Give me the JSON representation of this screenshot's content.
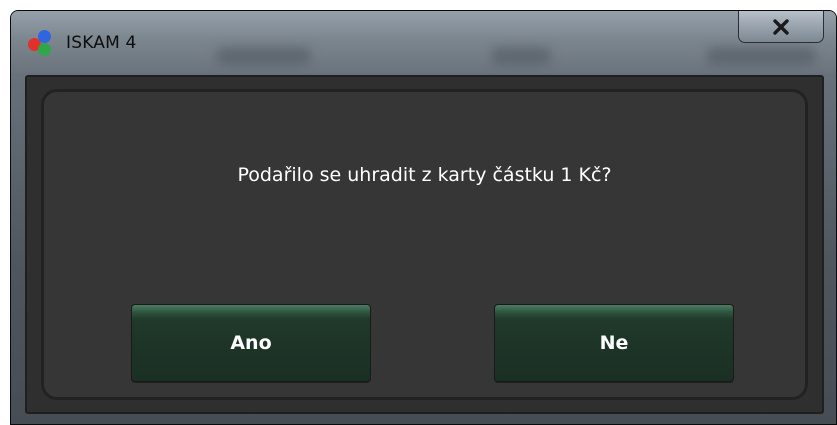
{
  "window": {
    "title": "ISKAM 4",
    "close_label": "close"
  },
  "dialog": {
    "message": "Podařilo se uhradit z karty částku 1 Kč?",
    "yes_label": "Ano",
    "no_label": "Ne"
  },
  "icons": {
    "app": "iskam-app-icon",
    "close": "close-icon"
  },
  "colors": {
    "panel_background": "#363636",
    "button_green": "#1c3326",
    "button_highlight": "#4d7d62",
    "text": "#ffffff"
  }
}
